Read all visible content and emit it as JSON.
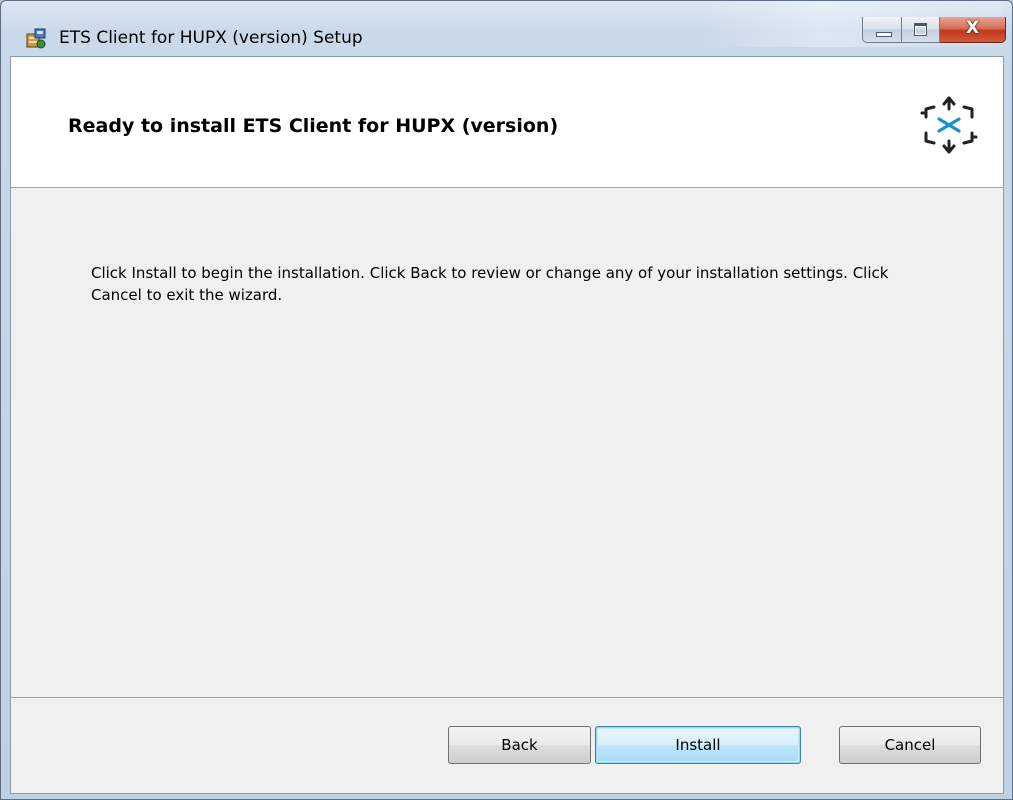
{
  "window": {
    "title": "ETS Client for HUPX (version) Setup",
    "app_icon": "installer-icon",
    "caption": {
      "minimize_icon": "minimize-icon",
      "maximize_icon": "maximize-icon",
      "close_label": "X"
    }
  },
  "banner": {
    "title": "Ready to install ETS Client for HUPX (version)",
    "logo_icon": "ets-logo-icon"
  },
  "body": {
    "text": "Click Install to begin the installation. Click Back to review or change any of your installation settings. Click Cancel to exit the wizard."
  },
  "buttons": {
    "back": "Back",
    "install": "Install",
    "cancel": "Cancel"
  },
  "colors": {
    "install_accent": "#3c7fb1",
    "close_red": "#c0381c",
    "logo_blue": "#1a8fd0"
  }
}
